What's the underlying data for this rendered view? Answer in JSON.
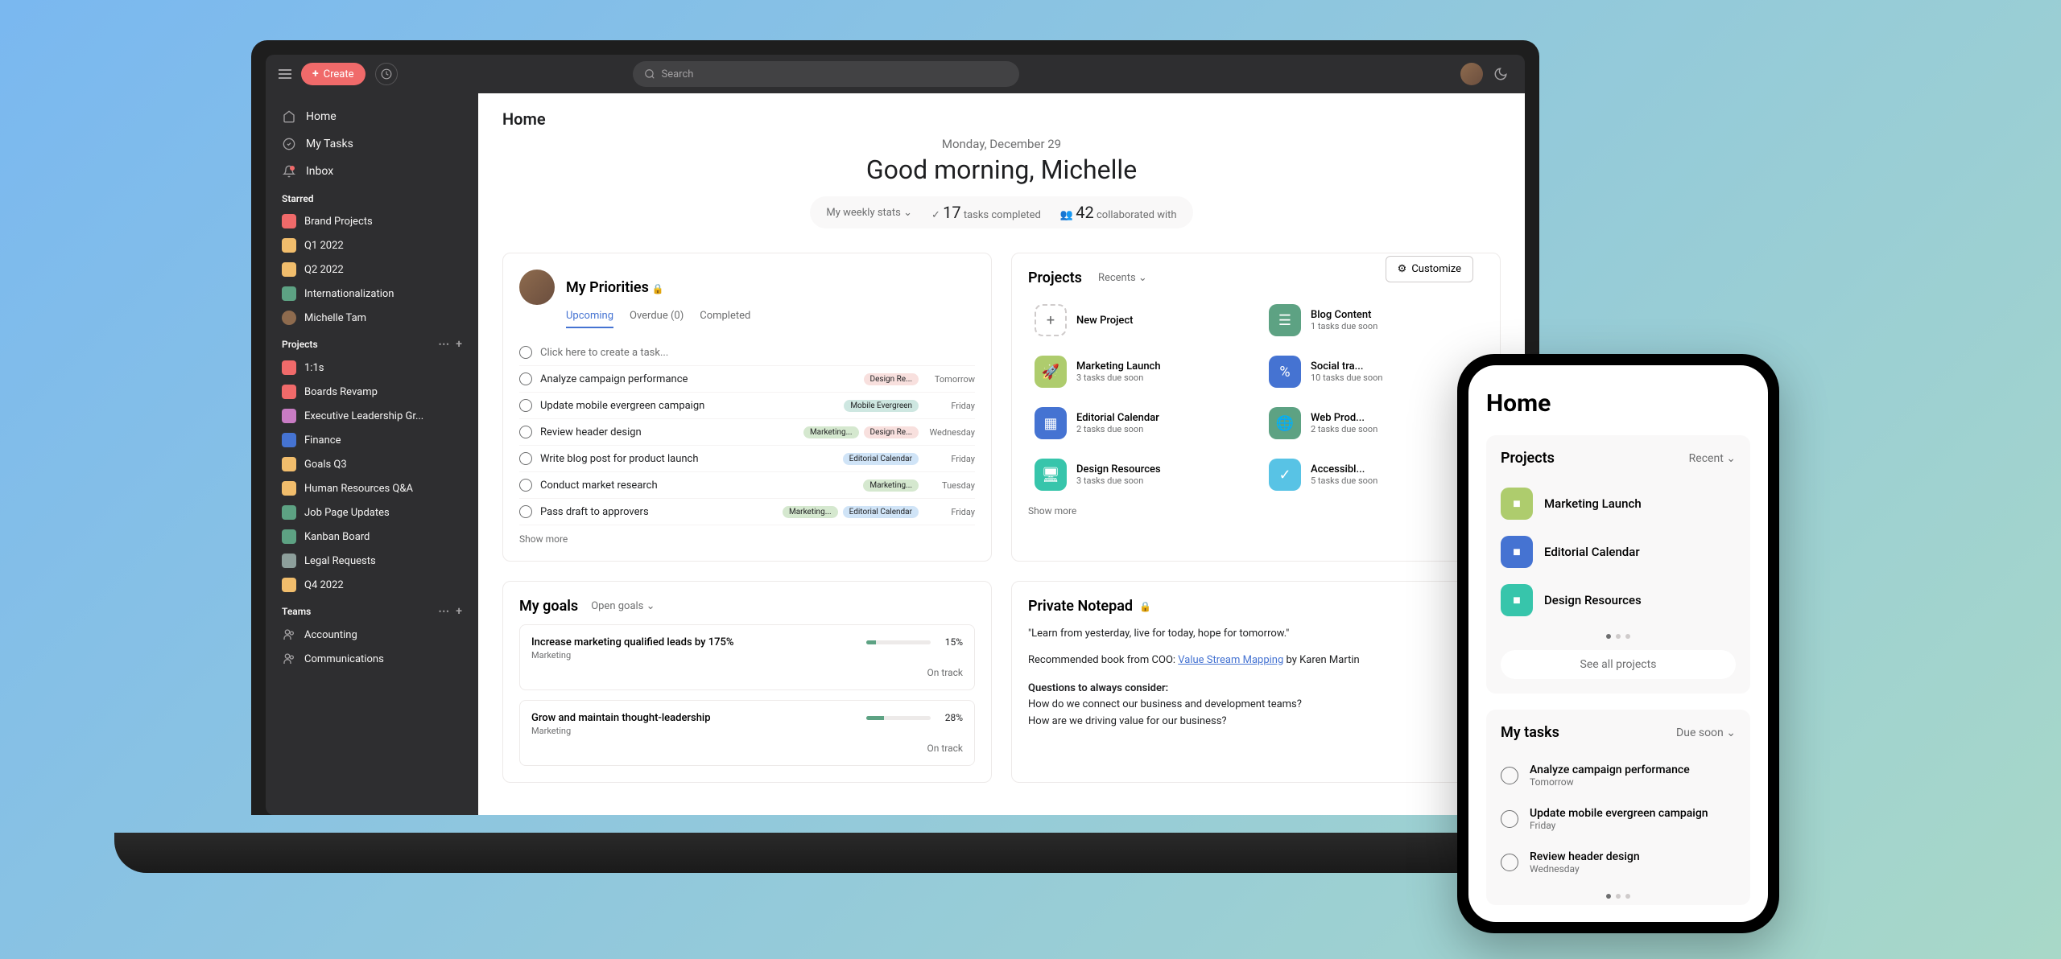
{
  "topbar": {
    "create": "Create",
    "search_placeholder": "Search"
  },
  "sidebar": {
    "nav": {
      "home": "Home",
      "tasks": "My Tasks",
      "inbox": "Inbox"
    },
    "starred": {
      "label": "Starred",
      "items": [
        {
          "name": "Brand Projects",
          "color": "#f06a6a"
        },
        {
          "name": "Q1 2022",
          "color": "#f1bd6c"
        },
        {
          "name": "Q2 2022",
          "color": "#f1bd6c"
        },
        {
          "name": "Internationalization",
          "color": "#5da283"
        },
        {
          "name": "Michelle Tam",
          "avatar": true
        }
      ]
    },
    "projects": {
      "label": "Projects",
      "items": [
        {
          "name": "1:1s",
          "color": "#f06a6a"
        },
        {
          "name": "Boards Revamp",
          "color": "#f06a6a"
        },
        {
          "name": "Executive Leadership Gr...",
          "color": "#c97cc4"
        },
        {
          "name": "Finance",
          "color": "#4573d2"
        },
        {
          "name": "Goals Q3",
          "color": "#f1bd6c"
        },
        {
          "name": "Human Resources Q&A",
          "color": "#f1bd6c"
        },
        {
          "name": "Job Page Updates",
          "color": "#5da283"
        },
        {
          "name": "Kanban Board",
          "color": "#5da283"
        },
        {
          "name": "Legal Requests",
          "color": "#8d9f9b"
        },
        {
          "name": "Q4 2022",
          "color": "#f1bd6c"
        }
      ]
    },
    "teams": {
      "label": "Teams",
      "items": [
        "Accounting",
        "Communications"
      ]
    }
  },
  "main": {
    "page_title": "Home",
    "date": "Monday, December 29",
    "greeting": "Good morning, Michelle",
    "stats_dd": "My weekly stats",
    "tasks_completed_num": "17",
    "tasks_completed_label": "tasks completed",
    "collab_num": "42",
    "collab_label": "collaborated with",
    "customize": "Customize"
  },
  "priorities": {
    "title": "My Priorities",
    "tabs": {
      "upcoming": "Upcoming",
      "overdue": "Overdue (0)",
      "completed": "Completed"
    },
    "placeholder": "Click here to create a task...",
    "tasks": [
      {
        "name": "Analyze campaign performance",
        "tags": [
          {
            "t": "Design Re...",
            "c": "#f8e0de"
          }
        ],
        "date": "Tomorrow"
      },
      {
        "name": "Update mobile evergreen campaign",
        "tags": [
          {
            "t": "Mobile Evergreen",
            "c": "#cee7e1"
          }
        ],
        "date": "Friday"
      },
      {
        "name": "Review header design",
        "tags": [
          {
            "t": "Marketing...",
            "c": "#d5e8cf"
          },
          {
            "t": "Design Re...",
            "c": "#f8e0de"
          }
        ],
        "date": "Wednesday"
      },
      {
        "name": "Write blog post for product launch",
        "tags": [
          {
            "t": "Editorial Calendar",
            "c": "#d0e4f7"
          }
        ],
        "date": "Friday"
      },
      {
        "name": "Conduct market research",
        "tags": [
          {
            "t": "Marketing...",
            "c": "#d5e8cf"
          }
        ],
        "date": "Tuesday"
      },
      {
        "name": "Pass draft to approvers",
        "tags": [
          {
            "t": "Marketing...",
            "c": "#d5e8cf"
          },
          {
            "t": "Editorial Calendar",
            "c": "#d0e4f7"
          }
        ],
        "date": "Friday"
      }
    ],
    "show_more": "Show more"
  },
  "projects_widget": {
    "title": "Projects",
    "recents": "Recents",
    "new": "New Project",
    "items": [
      {
        "name": "Blog Content",
        "sub": "1 tasks due soon",
        "color": "#5da283",
        "icon": "list"
      },
      {
        "name": "Marketing Launch",
        "sub": "3 tasks due soon",
        "color": "#aecc6d",
        "icon": "rocket"
      },
      {
        "name": "Social tra...",
        "sub": "10 tasks due soon",
        "color": "#4573d2",
        "icon": "percent"
      },
      {
        "name": "Editorial Calendar",
        "sub": "2 tasks due soon",
        "color": "#4573d2",
        "icon": "board"
      },
      {
        "name": "Web Prod...",
        "sub": "2 tasks due soon",
        "color": "#5da283",
        "icon": "globe"
      },
      {
        "name": "Design Resources",
        "sub": "3 tasks due soon",
        "color": "#37c5ab",
        "icon": "monitor"
      },
      {
        "name": "Accessibl...",
        "sub": "5 tasks due soon",
        "color": "#58c3e5",
        "icon": "check"
      }
    ],
    "show_more": "Show more"
  },
  "goals": {
    "title": "My goals",
    "dd": "Open goals",
    "items": [
      {
        "title": "Increase marketing qualified leads by 175%",
        "sub": "Marketing",
        "pct": "15%",
        "status": "On track",
        "fill": 15
      },
      {
        "title": "Grow and maintain thought-leadership",
        "sub": "Marketing",
        "pct": "28%",
        "status": "On track",
        "fill": 28
      }
    ]
  },
  "notepad": {
    "title": "Private Notepad",
    "quote": "\"Learn from yesterday, live for today, hope for tomorrow.\"",
    "rec_prefix": "Recommended book from COO: ",
    "rec_link": "Value Stream Mapping",
    "rec_suffix": " by Karen Martin",
    "q_header": "Questions to always consider:",
    "q1": "How do we connect our business and development teams?",
    "q2": "How are we driving value for our business?"
  },
  "phone": {
    "title": "Home",
    "projects_label": "Projects",
    "recent": "Recent",
    "projects": [
      {
        "name": "Marketing Launch",
        "color": "#aecc6d"
      },
      {
        "name": "Editorial Calendar",
        "color": "#4573d2"
      },
      {
        "name": "Design Resources",
        "color": "#37c5ab"
      }
    ],
    "see_all": "See all projects",
    "tasks_label": "My tasks",
    "due": "Due soon",
    "tasks": [
      {
        "name": "Analyze campaign performance",
        "date": "Tomorrow"
      },
      {
        "name": "Update mobile evergreen campaign",
        "date": "Friday"
      },
      {
        "name": "Review header design",
        "date": "Wednesday"
      }
    ]
  }
}
